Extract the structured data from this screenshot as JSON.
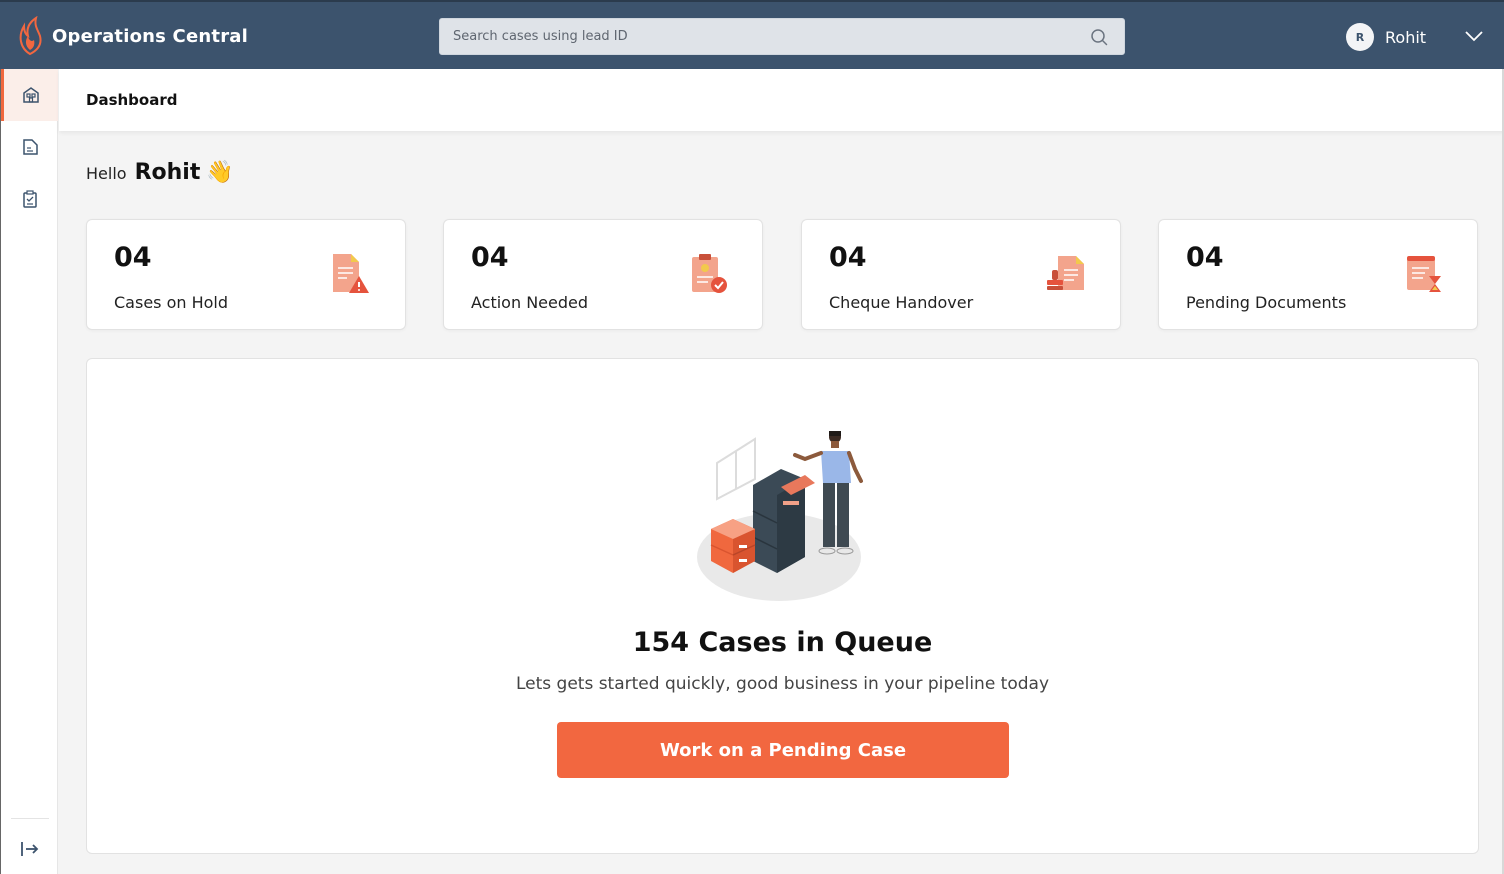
{
  "app": {
    "title": "Operations Central"
  },
  "search": {
    "placeholder": "Search cases using lead ID",
    "value": ""
  },
  "user": {
    "initial": "R",
    "name": "Rohit"
  },
  "page": {
    "title": "Dashboard"
  },
  "greeting": {
    "hello": "Hello",
    "name": "Rohit",
    "emoji": "👋"
  },
  "stats": [
    {
      "count": "04",
      "label": "Cases on Hold",
      "icon": "document-warning-icon"
    },
    {
      "count": "04",
      "label": "Action Needed",
      "icon": "clipboard-check-icon"
    },
    {
      "count": "04",
      "label": "Cheque Handover",
      "icon": "cheque-stamp-icon"
    },
    {
      "count": "04",
      "label": "Pending Documents",
      "icon": "document-hourglass-icon"
    }
  ],
  "queue": {
    "title": "154 Cases in Queue",
    "subtitle": "Lets gets started quickly, good business in your pipeline today",
    "button_label": "Work on a Pending Case"
  },
  "colors": {
    "topbar": "#3c536d",
    "accent": "#f26740",
    "background": "#f4f4f4"
  },
  "sidebar": {
    "items": [
      {
        "icon": "dashboard-icon",
        "active": true
      },
      {
        "icon": "document-icon",
        "active": false
      },
      {
        "icon": "checklist-icon",
        "active": false
      }
    ],
    "footer_icon": "collapse-icon"
  }
}
